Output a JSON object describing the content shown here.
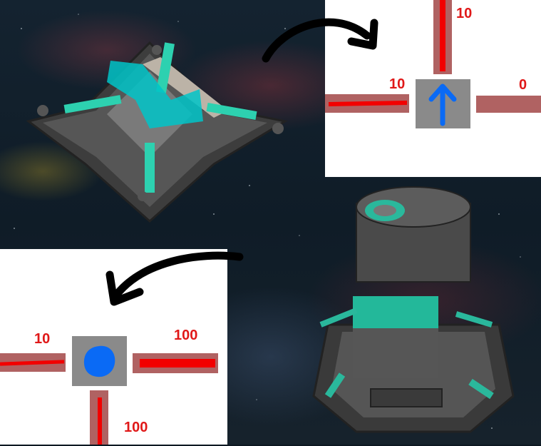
{
  "scene": {
    "background": "space-nebula",
    "objects": [
      "floor-tile-object",
      "tower-object"
    ]
  },
  "tile_diagram": {
    "top_value": "10",
    "left_value": "10",
    "right_value": "0",
    "center_icon": "arrow-up-icon",
    "colors": {
      "bar": "#b06262",
      "bar_core": "#f20000",
      "center": "#8a8a8a",
      "icon": "#0a6af5",
      "text": "#e01818"
    }
  },
  "tower_diagram": {
    "left_value": "10",
    "right_value": "100",
    "bottom_value": "100",
    "center_icon": "blue-dot-icon"
  },
  "arrows": [
    "curved-arrow-right-icon",
    "curved-arrow-left-icon"
  ]
}
